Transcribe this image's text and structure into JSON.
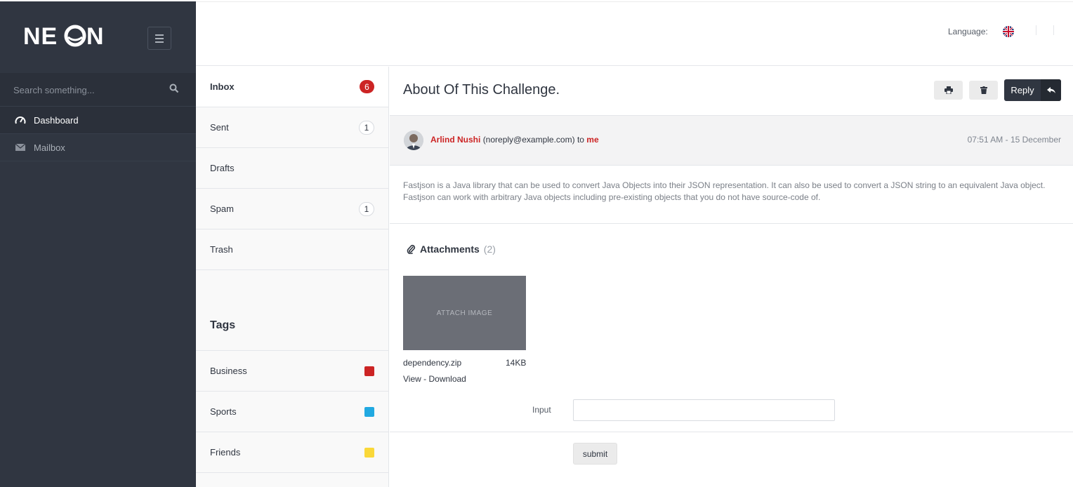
{
  "brand": {
    "logo_text": "NEON"
  },
  "sidebar": {
    "search_placeholder": "Search something...",
    "items": [
      {
        "label": "Dashboard",
        "icon": "gauge-icon",
        "active": true
      },
      {
        "label": "Mailbox",
        "icon": "envelope-icon",
        "active": false
      }
    ]
  },
  "header": {
    "language_label": "Language:",
    "language_flag": "uk-flag-icon"
  },
  "mail_nav": {
    "folders": [
      {
        "label": "Inbox",
        "count": "6",
        "active": true
      },
      {
        "label": "Sent",
        "count": "1"
      },
      {
        "label": "Drafts",
        "count": ""
      },
      {
        "label": "Spam",
        "count": "1"
      },
      {
        "label": "Trash",
        "count": ""
      }
    ],
    "tags_title": "Tags",
    "tags": [
      {
        "label": "Business",
        "color": "#cc2424"
      },
      {
        "label": "Sports",
        "color": "#21a9e1"
      },
      {
        "label": "Friends",
        "color": "#fad839"
      }
    ]
  },
  "message": {
    "title": "About Of This Challenge.",
    "reply_label": "Reply",
    "sender_name": "Arlind Nushi",
    "sender_email": "(noreply@example.com)",
    "to_word": "to",
    "recipient": "me",
    "date": "07:51 AM - 15 December",
    "body": "Fastjson is a Java library that can be used to convert Java Objects into their JSON representation. It can also be used to convert a JSON string to an equivalent Java object. Fastjson can work with arbitrary Java objects including pre-existing objects that you do not have source-code of.",
    "attachments_label": "Attachments",
    "attachments_count": "(2)",
    "attachment": {
      "thumb_text": "ATTACH IMAGE",
      "file_name": "dependency.zip",
      "file_size": "14KB",
      "view_label": "View",
      "separator": "-",
      "download_label": "Download"
    },
    "input_label": "Input",
    "input_value": "",
    "submit_label": "submit"
  },
  "colors": {
    "sidebar_bg": "#303641",
    "accent_red": "#cc2424",
    "reply_button": "#303641"
  }
}
